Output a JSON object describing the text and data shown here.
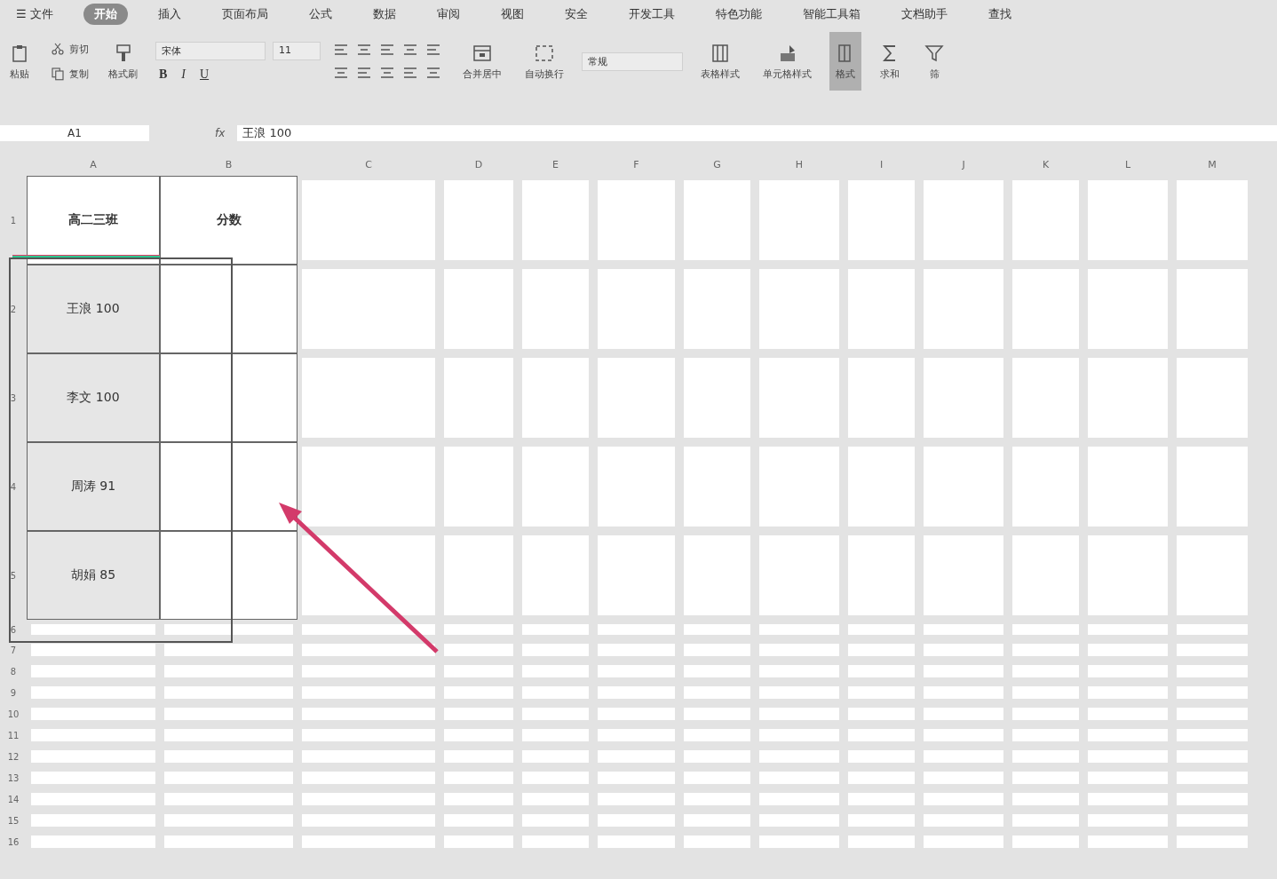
{
  "menu": [
    {
      "label": "☰ 文件",
      "selected": false
    },
    {
      "label": "开始",
      "selected": true
    },
    {
      "label": "插入",
      "selected": false
    },
    {
      "label": "页面布局",
      "selected": false
    },
    {
      "label": "公式",
      "selected": false
    },
    {
      "label": "数据",
      "selected": false
    },
    {
      "label": "审阅",
      "selected": false
    },
    {
      "label": "视图",
      "selected": false
    },
    {
      "label": "安全",
      "selected": false
    },
    {
      "label": "开发工具",
      "selected": false
    },
    {
      "label": "特色功能",
      "selected": false
    },
    {
      "label": "智能工具箱",
      "selected": false
    },
    {
      "label": "文档助手",
      "selected": false
    },
    {
      "label": "查找",
      "selected": false
    }
  ],
  "ribbon": [
    {
      "kind": "big",
      "label": "粘贴",
      "selected": false
    },
    {
      "kind": "pair",
      "items": [
        {
          "label": "剪切"
        },
        {
          "label": "复制"
        }
      ]
    },
    {
      "kind": "big",
      "label": "格式刷",
      "selected": false
    },
    {
      "kind": "font",
      "font": "宋体",
      "size": "11",
      "buttons": [
        "B",
        "I",
        "U"
      ]
    },
    {
      "kind": "align"
    },
    {
      "kind": "big",
      "label": "合并居中",
      "selected": false
    },
    {
      "kind": "big",
      "label": "自动换行",
      "selected": false
    },
    {
      "kind": "number",
      "format": "常规"
    },
    {
      "kind": "big",
      "label": "表格样式",
      "selected": false
    },
    {
      "kind": "big",
      "label": "单元格样式",
      "selected": false
    },
    {
      "kind": "big",
      "label": "格式",
      "selected": true
    },
    {
      "kind": "big",
      "label": "求和",
      "selected": false
    },
    {
      "kind": "big",
      "label": "筛",
      "selected": false
    }
  ],
  "formula_bar": {
    "name_box": "A1",
    "fx": "fx",
    "value": "王浪 100"
  },
  "columns": [
    "A",
    "B",
    "C",
    "D",
    "E",
    "F",
    "G",
    "H",
    "I",
    "J",
    "K",
    "L",
    "M"
  ],
  "rows": [
    {
      "number": "1",
      "cells": [
        "高二三班",
        "分数"
      ],
      "selected": false
    },
    {
      "number": "2",
      "cells": [
        "王浪 100"
      ],
      "selected": true
    },
    {
      "number": "3",
      "cells": [
        "李文 100"
      ],
      "selected": true
    },
    {
      "number": "4",
      "cells": [
        "周涛 91"
      ],
      "selected": true
    },
    {
      "number": "5",
      "cells": [
        "胡娟 85"
      ],
      "selected": true
    },
    {
      "number": "6",
      "cells": [],
      "selected": false
    },
    {
      "number": "7",
      "cells": [],
      "selected": false
    },
    {
      "number": "8",
      "cells": [],
      "selected": false
    },
    {
      "number": "9",
      "cells": [],
      "selected": false
    },
    {
      "number": "10",
      "cells": [],
      "selected": false
    },
    {
      "number": "11",
      "cells": [],
      "selected": false
    },
    {
      "number": "12",
      "cells": [],
      "selected": false
    },
    {
      "number": "13",
      "cells": [],
      "selected": false
    },
    {
      "number": "14",
      "cells": [],
      "selected": false
    },
    {
      "number": "15",
      "cells": [],
      "selected": false
    },
    {
      "number": "16",
      "cells": [],
      "selected": false
    }
  ]
}
